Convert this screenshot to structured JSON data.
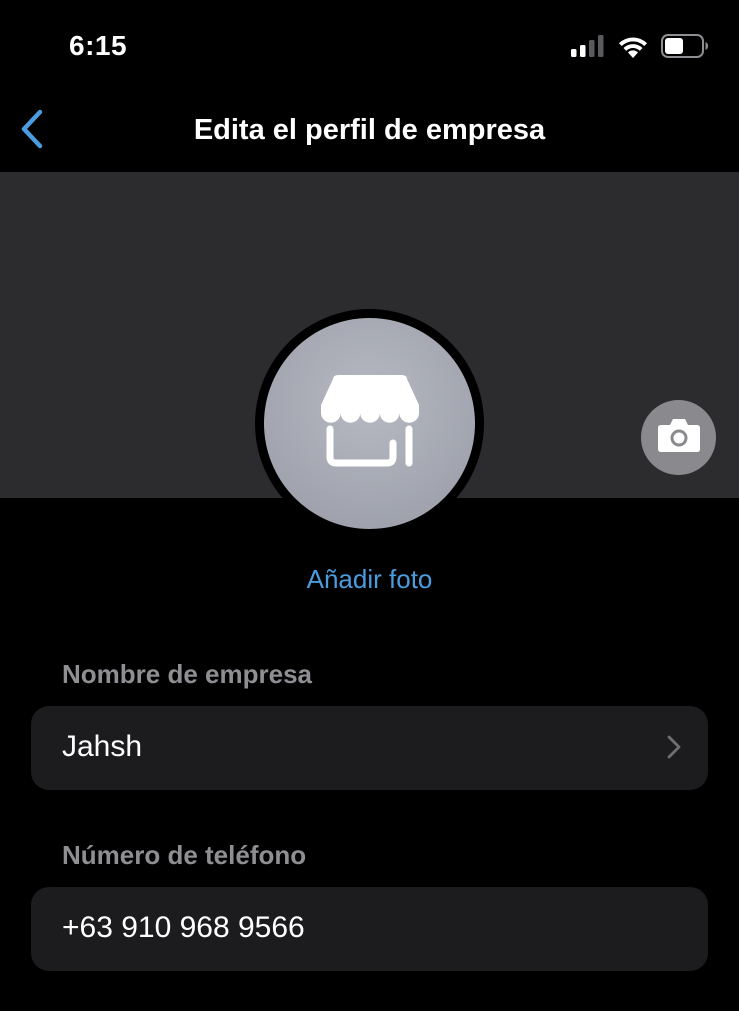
{
  "status_bar": {
    "time": "6:15",
    "icons": [
      "signal-icon",
      "wifi-icon",
      "battery-icon"
    ]
  },
  "nav": {
    "back_icon": "chevron-left-icon",
    "title": "Edita el perfil de empresa"
  },
  "profile": {
    "avatar_icon": "storefront-icon",
    "camera_icon": "camera-icon",
    "add_photo_label": "Añadir foto"
  },
  "fields": {
    "business_name": {
      "label": "Nombre de empresa",
      "value": "Jahsh",
      "icon": "chevron-right-icon"
    },
    "phone": {
      "label": "Número de teléfono",
      "value": "+63 910 968 9566"
    }
  },
  "colors": {
    "accent": "#4b9cde",
    "background": "#000000",
    "cover": "#2c2c2e",
    "field_bg": "#1c1c1e",
    "label": "#8e8e93"
  }
}
